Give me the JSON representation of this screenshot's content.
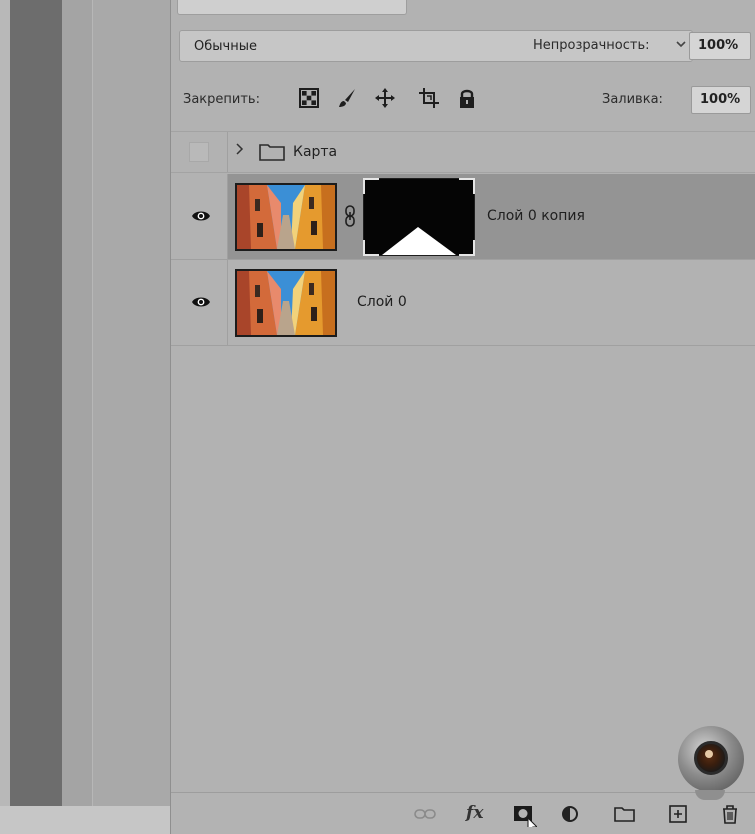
{
  "layers_panel": {
    "blend_mode": "Обычные",
    "opacity_label": "Непрозрачность:",
    "opacity_value": "100%",
    "lock_label": "Закрепить:",
    "fill_label": "Заливка:",
    "fill_value": "100%",
    "lock_icons": [
      "lock-transparent-pixels-icon",
      "lock-image-pixels-icon",
      "lock-position-icon",
      "lock-artboard-icon",
      "lock-all-icon"
    ],
    "group": {
      "name": "Карта",
      "icon": "folder-icon",
      "expanded": false
    },
    "layers": [
      {
        "name": "Слой 0 копия",
        "visible": true,
        "selected": true,
        "has_mask": true
      },
      {
        "name": "Слой 0",
        "visible": true,
        "selected": false,
        "has_mask": false
      }
    ],
    "footer_buttons": [
      "link-layers-icon",
      "fx-icon",
      "add-mask-icon",
      "adjustment-layer-icon",
      "new-group-icon",
      "new-layer-icon",
      "delete-icon"
    ],
    "fx_label": "fx"
  },
  "colors": {
    "panel_bg": "#b2b2b2",
    "selected_layer_bg": "#949494",
    "dark_strip": "#6d6d6d"
  }
}
